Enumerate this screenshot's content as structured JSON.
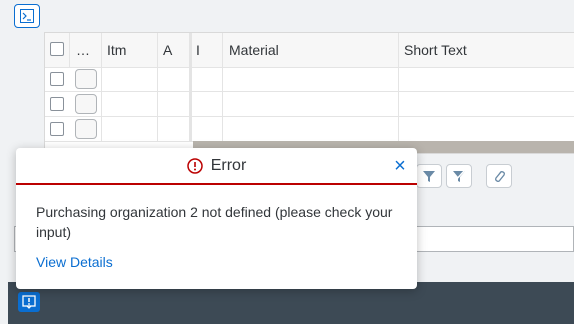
{
  "grid": {
    "columns": [
      "…",
      "Itm",
      "A",
      "I",
      "Material",
      "Short Text"
    ]
  },
  "dialog": {
    "title": "Error",
    "message": "Purchasing organization 2 not defined (please check your input)",
    "link": "View Details",
    "close_symbol": "×"
  },
  "colors": {
    "accent": "#0a6ed1",
    "error": "#bb0000",
    "bottom_bar": "#3d4a55"
  }
}
